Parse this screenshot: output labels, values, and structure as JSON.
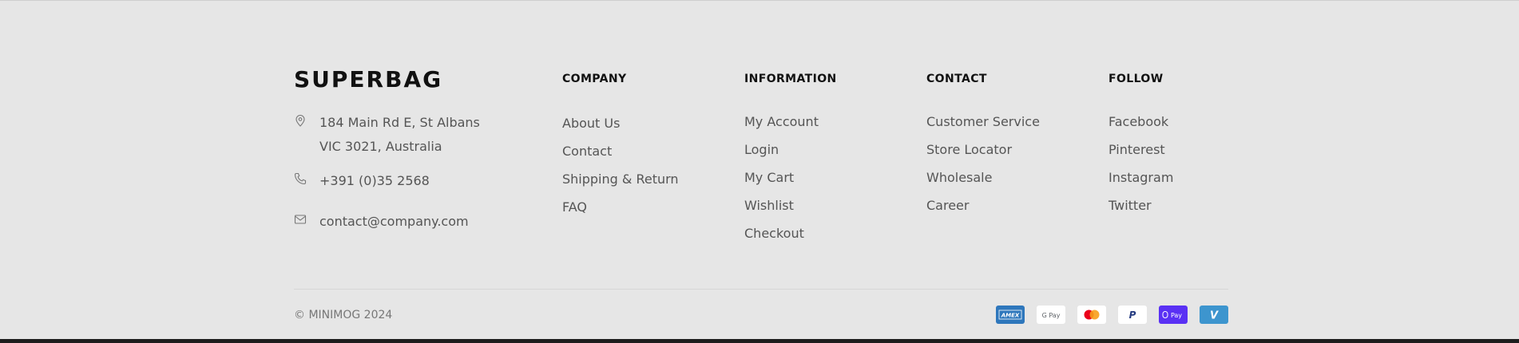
{
  "brand": "SUPERBAG",
  "contact_info": {
    "address_line1": "184 Main Rd E, St Albans",
    "address_line2": "VIC 3021, Australia",
    "phone": "+391 (0)35 2568",
    "email": "contact@company.com"
  },
  "columns": {
    "company": {
      "title": "COMPANY",
      "links": [
        "About Us",
        "Contact",
        "Shipping & Return",
        "FAQ"
      ]
    },
    "information": {
      "title": "INFORMATION",
      "links": [
        "My Account",
        "Login",
        "My Cart",
        "Wishlist",
        "Checkout"
      ]
    },
    "contact": {
      "title": "CONTACT",
      "links": [
        "Customer Service",
        "Store Locator",
        "Wholesale",
        "Career"
      ]
    },
    "follow": {
      "title": "FOLLOW",
      "links": [
        "Facebook",
        "Pinterest",
        "Instagram",
        "Twitter"
      ]
    }
  },
  "copyright": "© MINIMOG 2024",
  "payments": {
    "amex": {
      "label": "AMEX",
      "icon": "amex-icon",
      "color": "#2e77bc"
    },
    "gpay": {
      "label": "G Pay",
      "icon": "google-pay-icon",
      "color": "#ffffff"
    },
    "mastercard": {
      "icon": "mastercard-icon",
      "color": "#ffffff"
    },
    "paypal": {
      "label": "P",
      "icon": "paypal-icon",
      "color": "#ffffff"
    },
    "shoppay": {
      "label": "Pay",
      "icon": "shop-pay-icon",
      "color": "#5a31f4"
    },
    "venmo": {
      "label": "V",
      "icon": "venmo-icon",
      "color": "#3d95ce"
    }
  },
  "colors": {
    "background": "#e6e6e6",
    "heading": "#111111",
    "link": "#555555"
  }
}
